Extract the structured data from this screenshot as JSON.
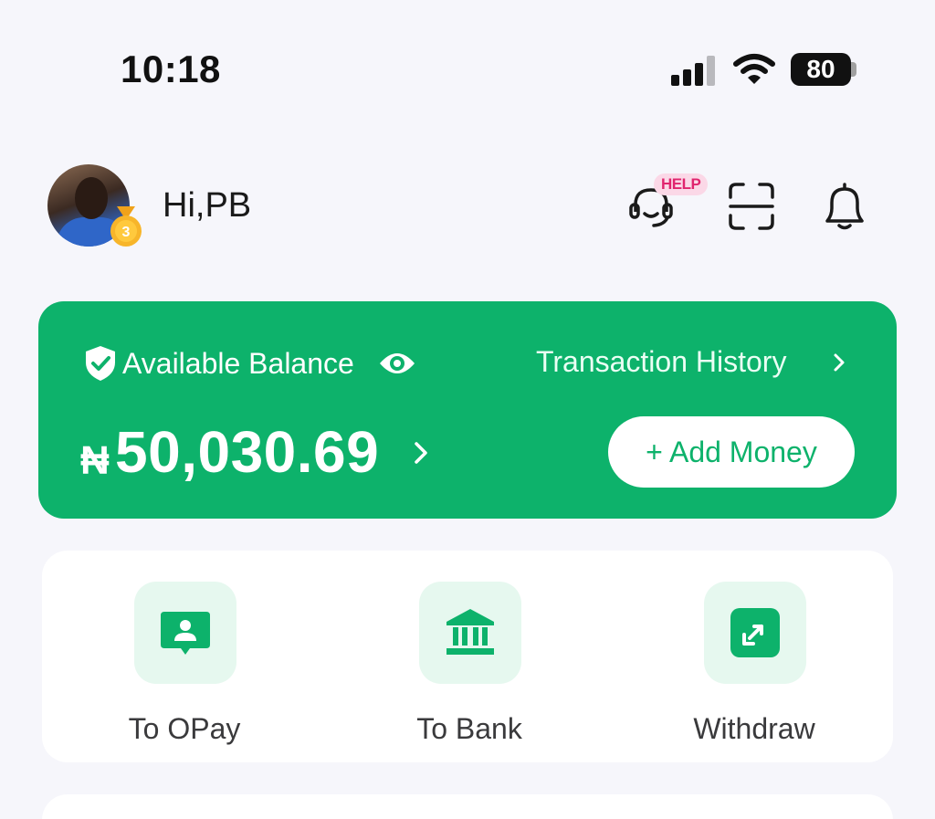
{
  "status_bar": {
    "time": "10:18",
    "battery": "80"
  },
  "header": {
    "greeting": "Hi,PB",
    "medal_level": "3",
    "help_badge": "HELP"
  },
  "balance": {
    "label": "Available Balance",
    "history_link": "Transaction History",
    "currency_symbol": "₦",
    "amount": "50,030.69",
    "add_money": "+ Add Money"
  },
  "actions": [
    {
      "label": "To OPay",
      "icon": "user-card-icon"
    },
    {
      "label": "To Bank",
      "icon": "bank-icon"
    },
    {
      "label": "Withdraw",
      "icon": "withdraw-icon"
    }
  ],
  "colors": {
    "brand_green": "#0db26b",
    "tile_bg": "#e6f8ef",
    "help_pink": "#e0246e",
    "background": "#f6f6fb"
  }
}
